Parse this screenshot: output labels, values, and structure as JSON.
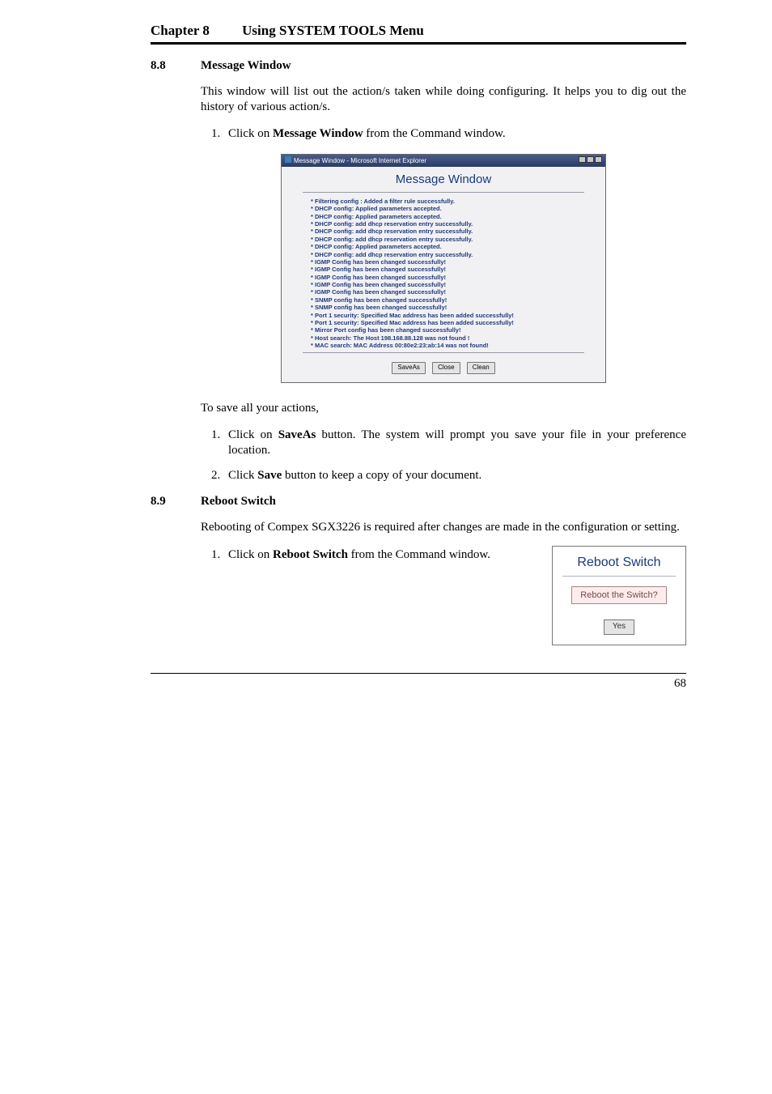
{
  "chapter": {
    "left": "Chapter 8",
    "right": "Using SYSTEM TOOLS Menu"
  },
  "s88": {
    "num": "8.8",
    "title": "Message Window",
    "intro": "This window will list out the action/s taken while doing configuring. It helps you to dig out the history of various action/s.",
    "step1_pre": "Click on ",
    "step1_bold": "Message Window",
    "step1_post": " from the Command window.",
    "save_intro": "To save all your actions,",
    "save1_pre": "Click on ",
    "save1_bold": "SaveAs",
    "save1_post": " button. The system will prompt you save your file in your preference location.",
    "save2_pre": "Click ",
    "save2_bold": "Save",
    "save2_post": " button to keep a copy of your document."
  },
  "msgwin": {
    "titlebar": "Message Window - Microsoft Internet Explorer",
    "heading": "Message Window",
    "lines": [
      "* Filtering config : Added a filter rule successfully.",
      "* DHCP config: Applied parameters accepted.",
      "* DHCP config: Applied parameters accepted.",
      "* DHCP config: add dhcp reservation entry successfully.",
      "* DHCP config: add dhcp reservation entry successfully.",
      "* DHCP config: add dhcp reservation entry successfully.",
      "* DHCP config: Applied parameters accepted.",
      "* DHCP config: add dhcp reservation entry successfully.",
      "* IGMP Config has been changed successfully!",
      "* IGMP Config has been changed successfully!",
      "* IGMP Config has been changed successfully!",
      "* IGMP Config has been changed successfully!",
      "* IGMP Config has been changed successfully!",
      "* SNMP config has been changed successfully!",
      "* SNMP config has been changed successfully!",
      "* Port 1 security: Specified Mac address has been added successfully!",
      "* Port 1 security: Specified Mac address has been added successfully!",
      "* Mirror Port config has been changed successfully!",
      "* Host search: The Host 198.168.88.128 was not found !",
      "* MAC search: MAC Address 00:80e2:23:ab:14 was not found!"
    ],
    "buttons": {
      "saveas": "SaveAs",
      "close": "Close",
      "clean": "Clean"
    }
  },
  "s89": {
    "num": "8.9",
    "title": "Reboot Switch",
    "intro": "Rebooting of Compex SGX3226 is required after changes are made in the configuration or setting.",
    "step1_pre": "Click on ",
    "step1_bold": "Reboot Switch",
    "step1_post": " from the Command window."
  },
  "reboot": {
    "title": "Reboot Switch",
    "prompt": "Reboot the Switch?",
    "yes": "Yes"
  },
  "footer": {
    "page": "68"
  }
}
